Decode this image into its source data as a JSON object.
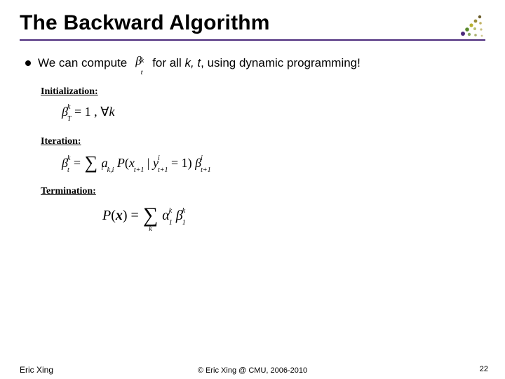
{
  "title": "The Backward Algorithm",
  "bullet": {
    "prefix": "We can compute",
    "symbol_html": "β",
    "sup": "k",
    "sub": "t",
    "suffix_a": "for all ",
    "vars": "k, t",
    "suffix_b": ", using dynamic programming!"
  },
  "sections": {
    "init_label": "Initialization:",
    "init_formula": "β_T^k = 1 , ∀k",
    "iter_label": "Iteration:",
    "iter_formula": "β_t^k = Σ_i a_{k,i} P( x_{t+1} | y_{t+1}^i = 1 ) β_{t+1}^i",
    "term_label": "Termination:",
    "term_formula": "P(x) = Σ_k α_1^k β_1^k"
  },
  "footer": {
    "author": "Eric Xing",
    "copyright": "© Eric Xing @ CMU, 2006-2010",
    "page": "22"
  }
}
